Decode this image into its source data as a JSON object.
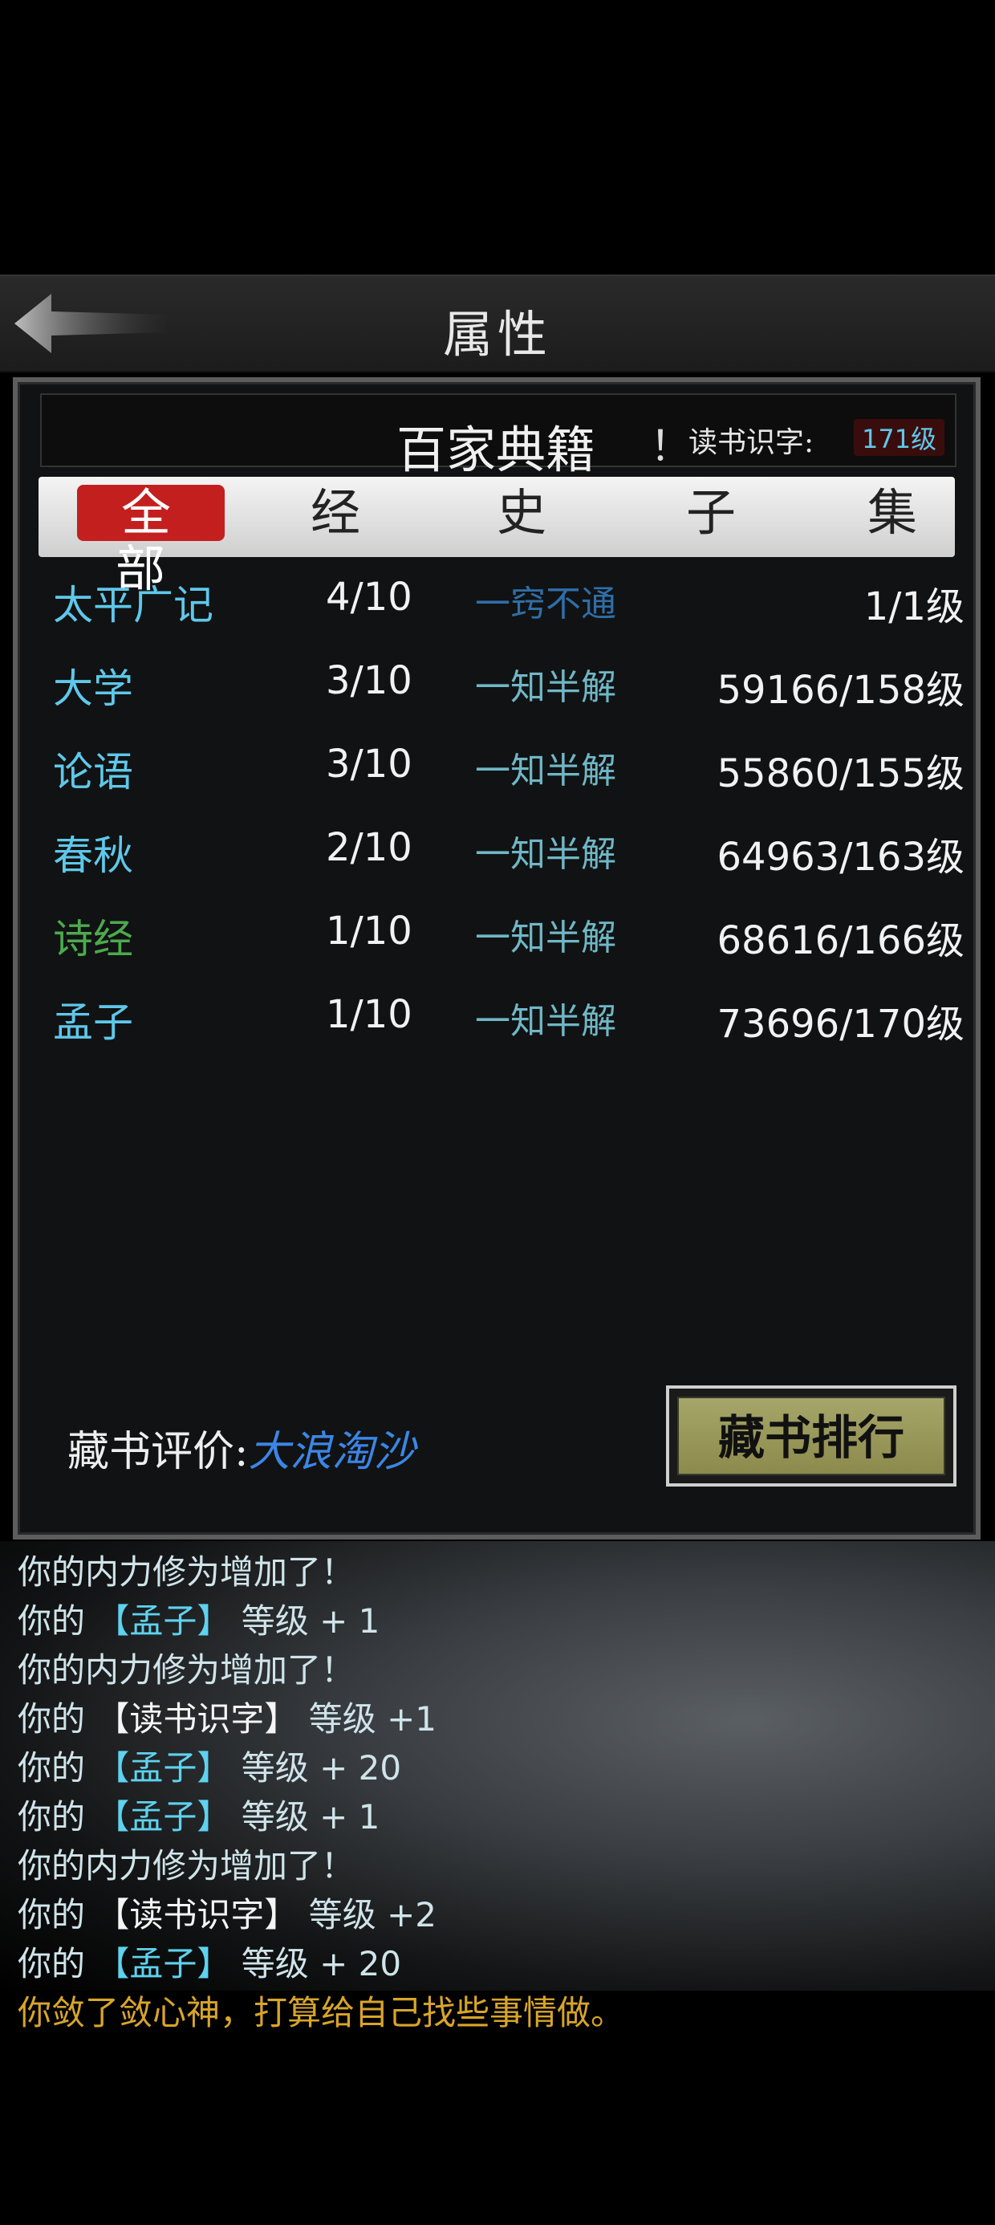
{
  "header": {
    "title": "属性"
  },
  "panel": {
    "title": "百家典籍",
    "bang": "！",
    "reading_label": "读书识字:",
    "reading_level": "171级"
  },
  "tabs": [
    {
      "label": "全部",
      "active": true
    },
    {
      "label": "经",
      "active": false
    },
    {
      "label": "史",
      "active": false
    },
    {
      "label": "子",
      "active": false
    },
    {
      "label": "集",
      "active": false
    }
  ],
  "books": [
    {
      "name": "太平广记",
      "progress": "4/10",
      "mastery": "一窍不通",
      "level": "1/1级",
      "name_color": "#5ec8ea",
      "mastery_color": "#2f6ea8"
    },
    {
      "name": "大学",
      "progress": "3/10",
      "mastery": "一知半解",
      "level": "59166/158级",
      "name_color": "#5ec8ea",
      "mastery_color": "#6fb7c6"
    },
    {
      "name": "论语",
      "progress": "3/10",
      "mastery": "一知半解",
      "level": "55860/155级",
      "name_color": "#5ec8ea",
      "mastery_color": "#6fb7c6"
    },
    {
      "name": "春秋",
      "progress": "2/10",
      "mastery": "一知半解",
      "level": "64963/163级",
      "name_color": "#5ec8ea",
      "mastery_color": "#6fb7c6"
    },
    {
      "name": "诗经",
      "progress": "1/10",
      "mastery": "一知半解",
      "level": "68616/166级",
      "name_color": "#4caa4c",
      "mastery_color": "#6fb7c6"
    },
    {
      "name": "孟子",
      "progress": "1/10",
      "mastery": "一知半解",
      "level": "73696/170级",
      "name_color": "#5ec8ea",
      "mastery_color": "#6fb7c6"
    }
  ],
  "footer": {
    "eval_label": "藏书评价:",
    "eval_value": "大浪淘沙",
    "rank_button": "藏书排行"
  },
  "log": [
    {
      "type": "plain",
      "text": "你的内力修为增加了！"
    },
    {
      "type": "parts",
      "p1": "你的 ",
      "p2": "【孟子】",
      "p3": " 等级 + 1",
      "highlight": "cyan"
    },
    {
      "type": "plain",
      "text": "你的内力修为增加了！"
    },
    {
      "type": "parts",
      "p1": "你的 ",
      "p2": "【读书识字】",
      "p3": " 等级 +1",
      "highlight": "white"
    },
    {
      "type": "parts",
      "p1": "你的 ",
      "p2": "【孟子】",
      "p3": " 等级 + 20",
      "highlight": "cyan"
    },
    {
      "type": "parts",
      "p1": "你的 ",
      "p2": "【孟子】",
      "p3": " 等级 + 1",
      "highlight": "cyan"
    },
    {
      "type": "plain",
      "text": "你的内力修为增加了！"
    },
    {
      "type": "parts",
      "p1": "你的 ",
      "p2": "【读书识字】",
      "p3": " 等级 +2",
      "highlight": "white"
    },
    {
      "type": "parts",
      "p1": "你的 ",
      "p2": "【孟子】",
      "p3": " 等级 + 20",
      "highlight": "cyan"
    },
    {
      "type": "gold",
      "text": "你敛了敛心神，打算给自己找些事情做。"
    }
  ]
}
